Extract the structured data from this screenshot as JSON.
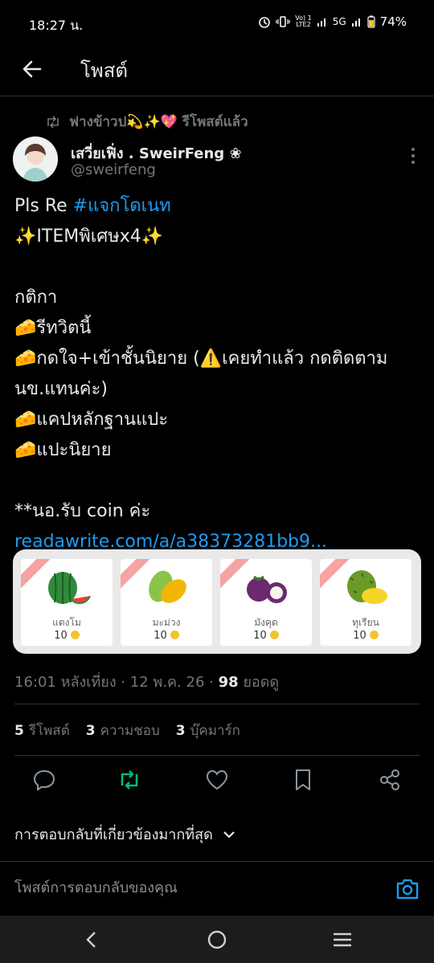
{
  "status_bar": {
    "time": "18:27 น.",
    "network_top": "Vo) 1",
    "network_bottom": "LTE2",
    "network_type": "5G",
    "battery": "74%"
  },
  "header": {
    "title": "โพสต์"
  },
  "repost": {
    "text": "ฟางข้าวป💫✨💖 รีโพสต์แล้ว"
  },
  "author": {
    "name": "เสวี่ยเฟิ่ง . SweirFeng ❀",
    "handle": "@sweirfeng"
  },
  "post": {
    "line1_text": "Pls Re ",
    "line1_hashtag": "#แจกโดเนท",
    "line2": "✨ITEMพิเศษx4✨",
    "line3": "",
    "line4": "กติกา",
    "line5": "🧀รีทวิตนี้",
    "line6": "🧀กดใจ+เข้าชั้นนิยาย (⚠️เคยทำแล้ว กดติดตาม",
    "line7": "นข.แทนค่ะ)",
    "line8": "🧀แคปหลักฐานแปะ",
    "line9": "🧀แปะนิยาย",
    "line10": "",
    "line11": "**นอ.รับ coin ค่ะ",
    "link": "readawrite.com/a/a38373281bb9..."
  },
  "items": [
    {
      "name": "แตงโม",
      "price": "10",
      "icon": "watermelon-icon"
    },
    {
      "name": "มะม่วง",
      "price": "10",
      "icon": "mango-icon"
    },
    {
      "name": "มังคุด",
      "price": "10",
      "icon": "mangosteen-icon"
    },
    {
      "name": "ทุเรียน",
      "price": "10",
      "icon": "durian-icon"
    }
  ],
  "meta": {
    "time": "16:01 หลังเที่ยง · 12 พ.ค. 26 · ",
    "views_count": "98",
    "views_label": " ยอดดู"
  },
  "stats": {
    "reposts_count": "5",
    "reposts_label": "รีโพสต์",
    "likes_count": "3",
    "likes_label": "ความชอบ",
    "bookmarks_count": "3",
    "bookmarks_label": "บุ๊คมาร์ก"
  },
  "replies": {
    "sort_label": "การตอบกลับที่เกี่ยวข้องมากที่สุด",
    "placeholder": "โพสต์การตอบกลับของคุณ"
  },
  "colors": {
    "accent": "#1d9bf0",
    "repost_active": "#00ba7c",
    "muted": "#71767b"
  }
}
